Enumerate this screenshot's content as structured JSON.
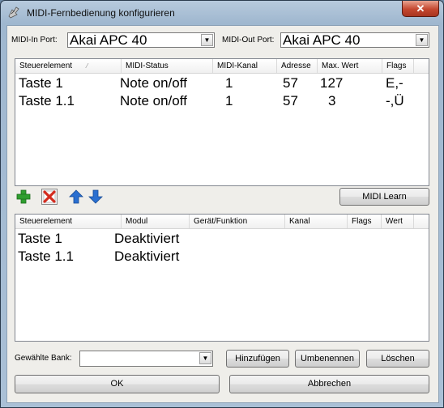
{
  "window": {
    "title": "MIDI-Fernbedienung konfigurieren",
    "close_label": "✕"
  },
  "ports": {
    "midi_in_label": "MIDI-In Port:",
    "midi_in_value": "Akai APC 40",
    "midi_out_label": "MIDI-Out Port:",
    "midi_out_value": "Akai APC 40"
  },
  "top_table": {
    "columns": [
      "Steuerelement",
      "MIDI-Status",
      "MIDI-Kanal",
      "Adresse",
      "Max. Wert",
      "Flags"
    ],
    "rows": [
      [
        "Taste 1",
        "Note on/off",
        "1",
        "57",
        "127",
        "E,-"
      ],
      [
        "Taste 1.1",
        "Note on/off",
        "1",
        "57",
        "3",
        "-,Ü"
      ]
    ]
  },
  "toolbar": {
    "midi_learn_label": "MIDI Learn"
  },
  "bottom_table": {
    "columns": [
      "Steuerelement",
      "Modul",
      "Gerät/Funktion",
      "Kanal",
      "Flags",
      "Wert"
    ],
    "rows": [
      [
        "Taste 1",
        "Deaktiviert"
      ],
      [
        "Taste 1.1",
        "Deaktiviert"
      ]
    ]
  },
  "bank": {
    "label": "Gewählte Bank:",
    "value": "",
    "add_label": "Hinzufügen",
    "rename_label": "Umbenennen",
    "delete_label": "Löschen"
  },
  "footer": {
    "ok_label": "OK",
    "cancel_label": "Abbrechen"
  },
  "colors": {
    "add_icon": "#2f9e2f",
    "delete_icon": "#d42b1e",
    "arrow_icon": "#2a6fd0"
  }
}
